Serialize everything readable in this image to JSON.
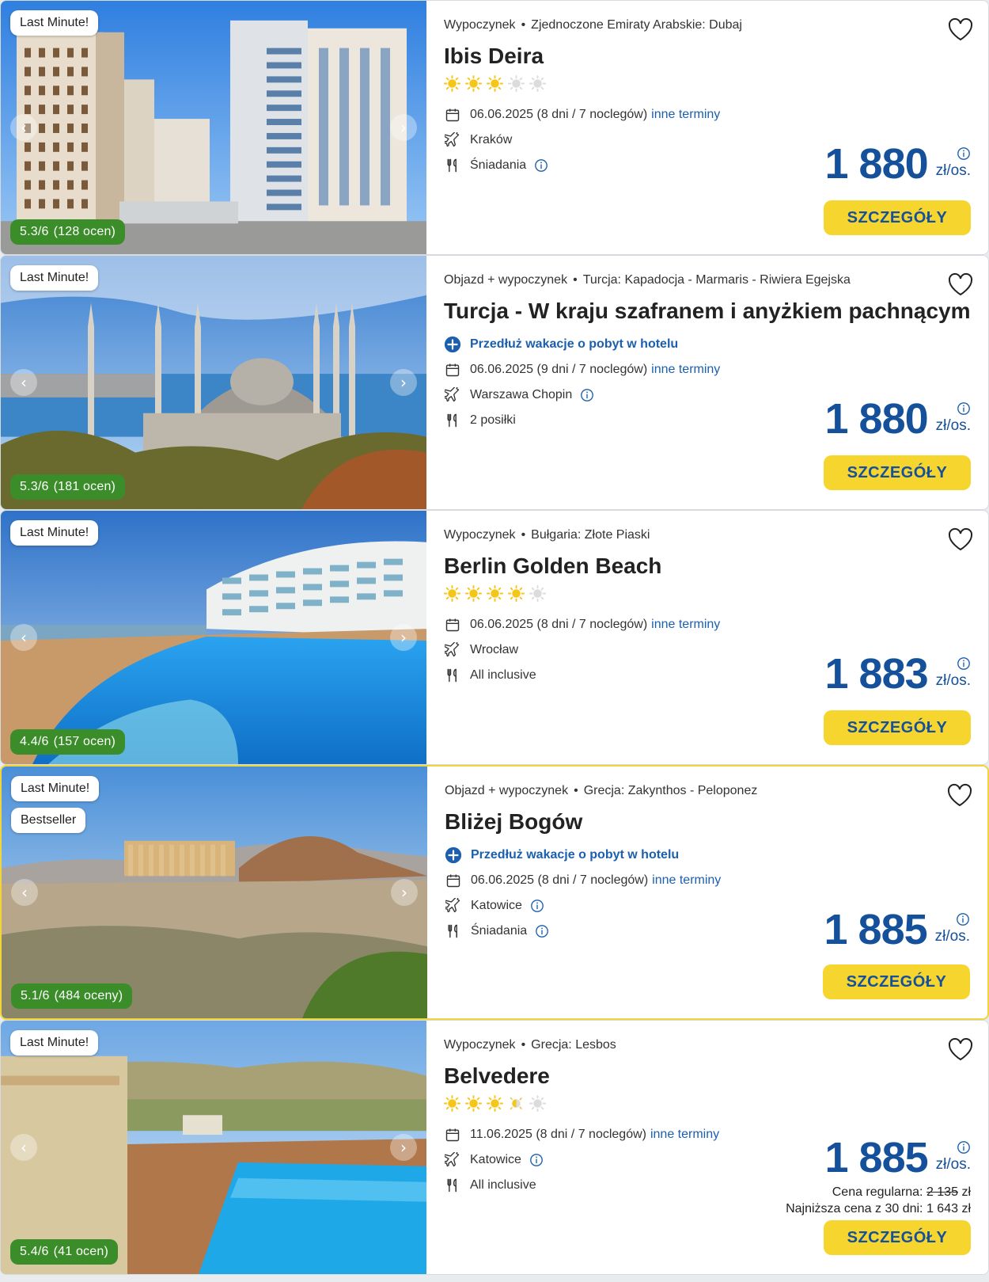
{
  "colors": {
    "price": "#15509b",
    "button": "#f7d52f",
    "rating": "#3b8d2a",
    "highlight": "#f2d43b",
    "star_on": "#f5c518",
    "star_off": "#dcdcdc"
  },
  "offers": [
    {
      "tags": [
        "Last Minute!"
      ],
      "rating": "5.3/6",
      "votes": "(128 ocen)",
      "type": "Wypoczynek",
      "destination": "Zjednoczone Emiraty Arabskie: Dubaj",
      "title": "Ibis Deira",
      "stars": 3,
      "date": "06.06.2025 (8 dni / 7 noclegów)",
      "other_dates": "inne terminy",
      "departure": "Kraków",
      "departure_info": false,
      "board": "Śniadania",
      "board_info": true,
      "price": "1 880",
      "unit": "zł/os.",
      "button": "SZCZEGÓŁY"
    },
    {
      "tags": [
        "Last Minute!"
      ],
      "rating": "5.3/6",
      "votes": "(181 ocen)",
      "type": "Objazd + wypoczynek",
      "destination": "Turcja: Kapadocja - Marmaris - Riwiera Egejska",
      "title": "Turcja - W kraju szafranem i anyżkiem pachnącym",
      "stars": 0,
      "extend": "Przedłuż wakacje o pobyt w hotelu",
      "date": "06.06.2025 (9 dni / 7 noclegów)",
      "other_dates": "inne terminy",
      "departure": "Warszawa Chopin",
      "departure_info": true,
      "board": "2 posiłki",
      "board_info": false,
      "price": "1 880",
      "unit": "zł/os.",
      "button": "SZCZEGÓŁY"
    },
    {
      "tags": [
        "Last Minute!"
      ],
      "rating": "4.4/6",
      "votes": "(157 ocen)",
      "type": "Wypoczynek",
      "destination": "Bułgaria: Złote Piaski",
      "title": "Berlin Golden Beach",
      "stars": 4,
      "date": "06.06.2025 (8 dni / 7 noclegów)",
      "other_dates": "inne terminy",
      "departure": "Wrocław",
      "departure_info": false,
      "board": "All inclusive",
      "board_info": false,
      "price": "1 883",
      "unit": "zł/os.",
      "button": "SZCZEGÓŁY"
    },
    {
      "tags": [
        "Last Minute!",
        "Bestseller"
      ],
      "rating": "5.1/6",
      "votes": "(484 oceny)",
      "type": "Objazd + wypoczynek",
      "destination": "Grecja: Zakynthos - Peloponez",
      "title": "Bliżej Bogów",
      "stars": 0,
      "extend": "Przedłuż wakacje o pobyt w hotelu",
      "date": "06.06.2025 (8 dni / 7 noclegów)",
      "other_dates": "inne terminy",
      "departure": "Katowice",
      "departure_info": true,
      "board": "Śniadania",
      "board_info": true,
      "price": "1 885",
      "unit": "zł/os.",
      "button": "SZCZEGÓŁY"
    },
    {
      "tags": [
        "Last Minute!"
      ],
      "rating": "5.4/6",
      "votes": "(41 ocen)",
      "type": "Wypoczynek",
      "destination": "Grecja: Lesbos",
      "title": "Belvedere",
      "stars": 3.5,
      "date": "11.06.2025 (8 dni / 7 noclegów)",
      "other_dates": "inne terminy",
      "departure": "Katowice",
      "departure_info": true,
      "board": "All inclusive",
      "board_info": false,
      "price": "1 885",
      "unit": "zł/os.",
      "button": "SZCZEGÓŁY",
      "regular_label": "Cena regularna:",
      "regular_price": "2 135",
      "regular_currency": "zł",
      "lowest_label": "Najniższa cena z 30 dni:",
      "lowest_price": "1 643 zł"
    }
  ]
}
